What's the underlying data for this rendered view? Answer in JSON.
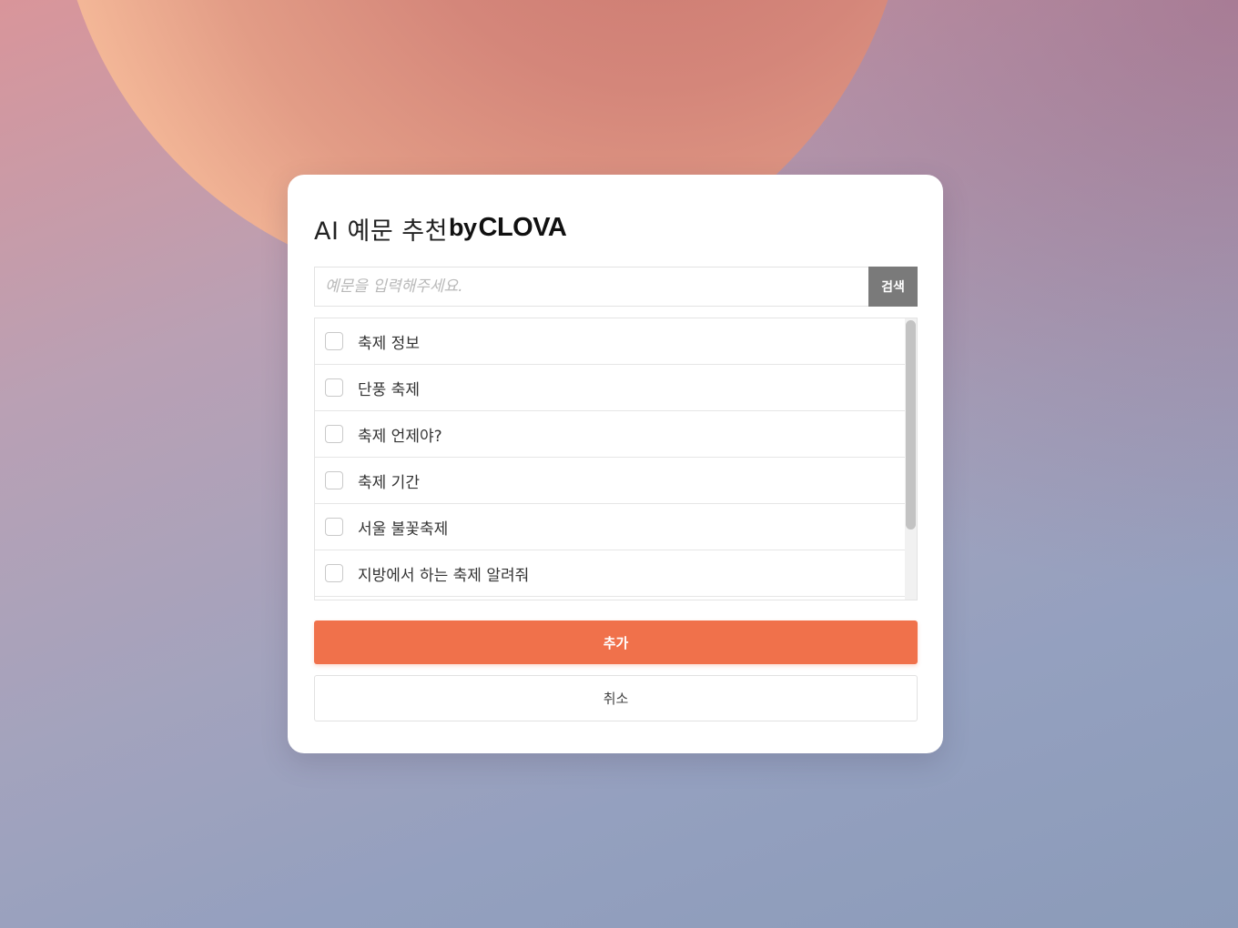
{
  "dialog": {
    "title": "AI 예문 추천",
    "brand_by": "by",
    "brand_name": "CLOVA"
  },
  "search": {
    "placeholder": "예문을 입력해주세요.",
    "value": "",
    "button_label": "검색"
  },
  "suggestions": {
    "items": [
      {
        "label": "축제 정보",
        "checked": false
      },
      {
        "label": "단풍 축제",
        "checked": false
      },
      {
        "label": "축제 언제야?",
        "checked": false
      },
      {
        "label": "축제 기간",
        "checked": false
      },
      {
        "label": "서울 불꽃축제",
        "checked": false
      },
      {
        "label": "지방에서 하는 축제 알려줘",
        "checked": false
      }
    ],
    "scroll_position": 0
  },
  "actions": {
    "add_label": "추가",
    "cancel_label": "취소"
  },
  "colors": {
    "accent": "#f0714b",
    "search_button": "#7a7a7a"
  }
}
